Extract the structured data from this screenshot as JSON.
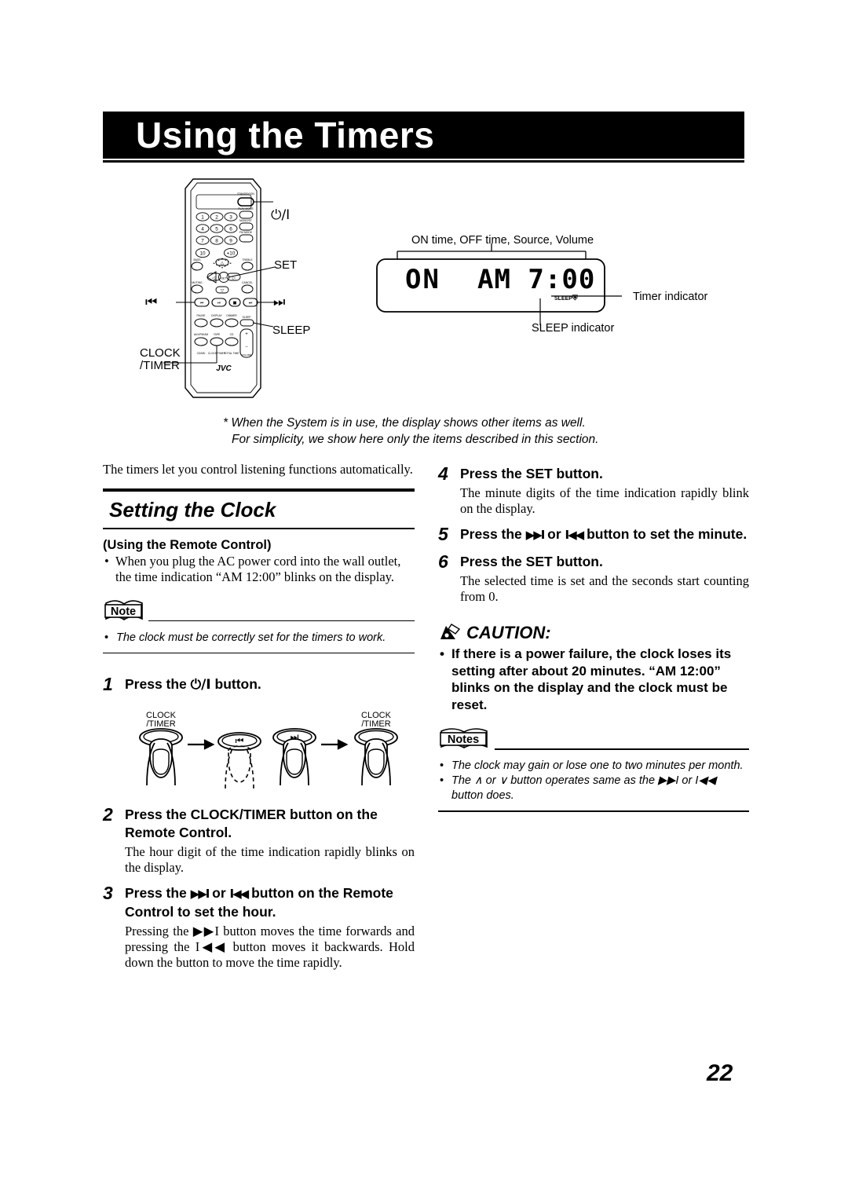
{
  "page": {
    "title": "Using the Timers",
    "number": "22"
  },
  "remote": {
    "callouts": {
      "power": "⏻/I",
      "set": "SET",
      "sleep": "SLEEP",
      "prev": "⏮",
      "next": "⏭",
      "clock_timer_line1": "CLOCK",
      "clock_timer_line2": "/TIMER"
    },
    "brand": "JVC",
    "keypad": [
      "1",
      "2",
      "3",
      "4",
      "5",
      "6",
      "7",
      "8",
      "9",
      "10",
      "+10"
    ]
  },
  "display": {
    "top_label": "ON time, OFF time, Source, Volume",
    "lcd_left": "ON",
    "lcd_right": "AM 7:00",
    "sleep_text": "SLEEP",
    "timer_indicator_label": "Timer indicator",
    "sleep_indicator_label": "SLEEP indicator"
  },
  "footnote": {
    "line1": "* When the System is in use, the display shows other items as well.",
    "line2": "For simplicity, we show here only the items described in this section."
  },
  "left_column": {
    "intro": "The timers let you control listening functions automatically.",
    "section_title": "Setting the Clock",
    "subhead": "(Using the Remote Control)",
    "bullets": [
      "When you plug the AC power cord into the wall outlet, the time indication “AM 12:00” blinks on the display."
    ],
    "note_label": "Note",
    "notes": [
      "The clock must be correctly set for the timers to work."
    ],
    "steps": [
      {
        "num": "1",
        "head_pre": "Press the ",
        "head_glyph": "⏻/I",
        "head_post": " button.",
        "body": ""
      },
      {
        "num": "2",
        "head_pre": "Press the CLOCK/TIMER button on the Remote Control.",
        "head_glyph": "",
        "head_post": "",
        "body": "The hour digit of the time indication rapidly blinks on the display."
      },
      {
        "num": "3",
        "head_pre": "Press the ",
        "head_glyph": "▶▶I",
        "head_mid": " or ",
        "head_glyph2": "I◀◀",
        "head_post": " button on the Remote Control to set the hour.",
        "body": "Pressing the ▶▶I button moves the time forwards and pressing the I◀◀ button moves it backwards. Hold down the button to move the time rapidly."
      }
    ],
    "hand_diagram": {
      "btn1_label_line1": "CLOCK",
      "btn1_label_line2": "/TIMER",
      "btn2_glyph": "I◀◀",
      "btn3_glyph": "▶▶I",
      "btn4_label_line1": "CLOCK",
      "btn4_label_line2": "/TIMER"
    }
  },
  "right_column": {
    "steps": [
      {
        "num": "4",
        "head_pre": "Press the SET button.",
        "head_glyph": "",
        "head_post": "",
        "body": "The minute digits of the time indication rapidly blink on the display."
      },
      {
        "num": "5",
        "head_pre": "Press the ",
        "head_glyph": "▶▶I",
        "head_mid": " or ",
        "head_glyph2": "I◀◀",
        "head_post": " button to set the minute.",
        "body": ""
      },
      {
        "num": "6",
        "head_pre": "Press the SET button.",
        "head_glyph": "",
        "head_post": "",
        "body": "The selected time is set and the seconds start counting from 0."
      }
    ],
    "caution_label": "CAUTION:",
    "caution_bullets": [
      "If there is a power failure, the clock loses its setting after about 20 minutes. “AM 12:00” blinks on the display and the clock must be reset."
    ],
    "notes_label": "Notes",
    "notes": [
      "The clock may gain or lose one to two minutes per month.",
      "The ∧ or ∨ button operates same as the ▶▶I or I◀◀ button does."
    ]
  },
  "colors": {
    "ink": "#000000",
    "paper": "#ffffff"
  }
}
